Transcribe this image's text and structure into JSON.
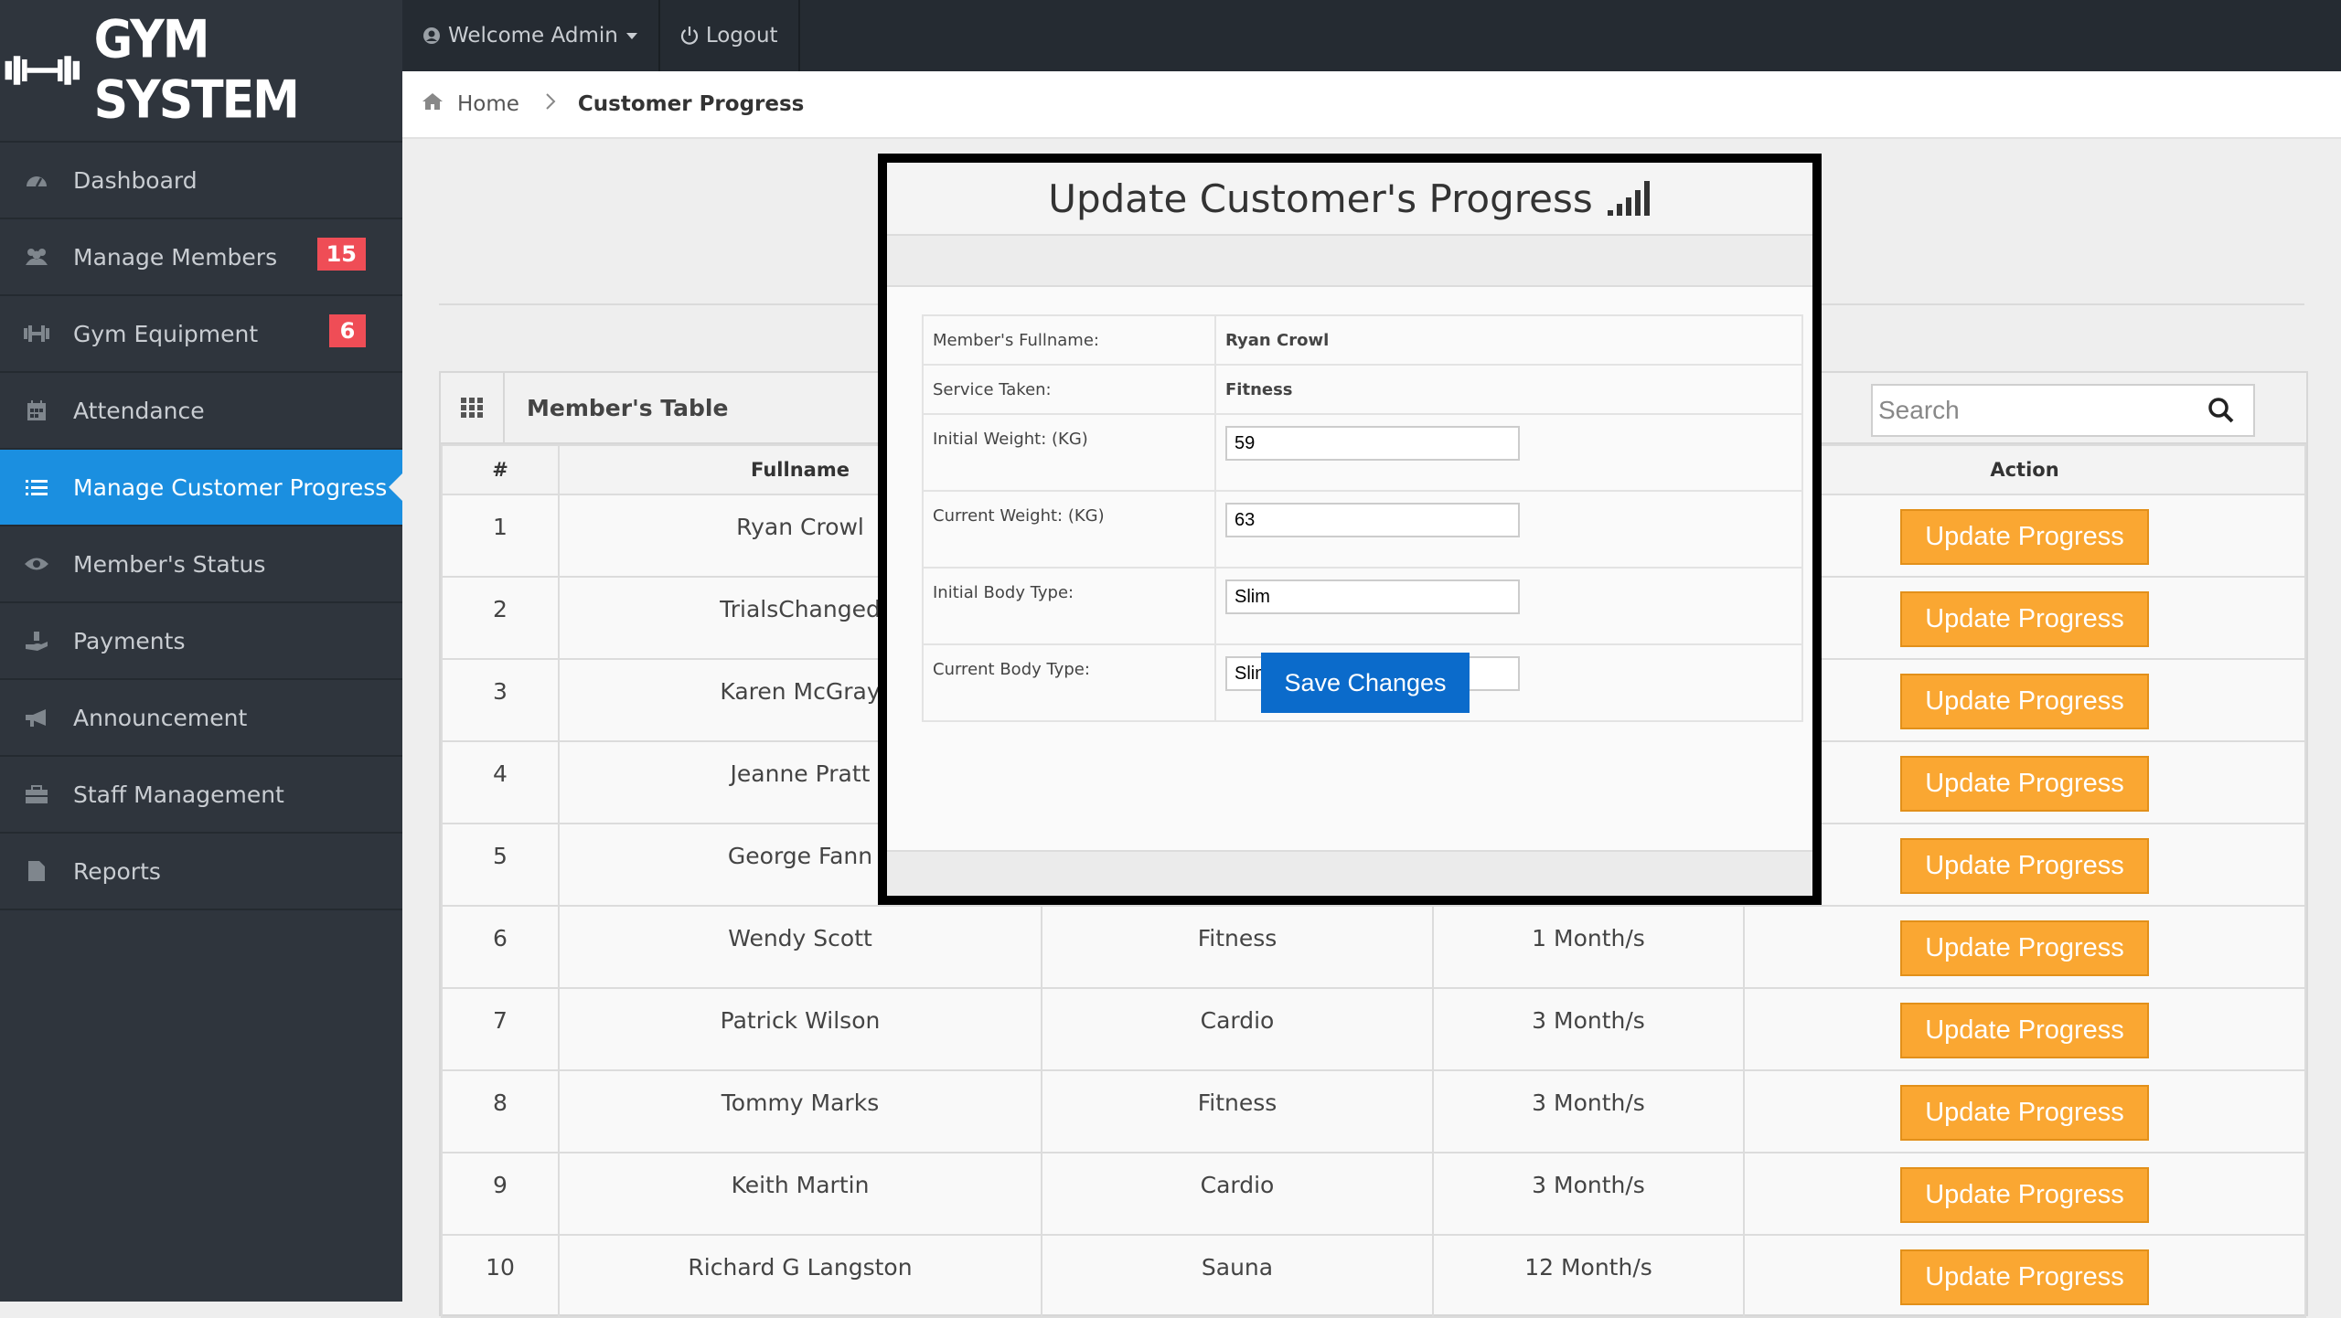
{
  "app": {
    "logo_text": "GYM SYSTEM"
  },
  "topbar": {
    "welcome": "Welcome Admin",
    "logout": "Logout"
  },
  "breadcrumb": {
    "home": "Home",
    "current": "Customer Progress"
  },
  "sidebar": {
    "items": [
      {
        "label": "Dashboard",
        "icon": "dashboard-icon"
      },
      {
        "label": "Manage Members",
        "icon": "users-icon",
        "badge": "15"
      },
      {
        "label": "Gym Equipment",
        "icon": "dumbbell-icon",
        "badge": "6"
      },
      {
        "label": "Attendance",
        "icon": "calendar-icon"
      },
      {
        "label": "Manage Customer Progress",
        "icon": "list-icon",
        "active": true
      },
      {
        "label": "Member's Status",
        "icon": "eye-icon"
      },
      {
        "label": "Payments",
        "icon": "hand-money-icon"
      },
      {
        "label": "Announcement",
        "icon": "megaphone-icon"
      },
      {
        "label": "Staff Management",
        "icon": "briefcase-icon"
      },
      {
        "label": "Reports",
        "icon": "file-icon"
      }
    ]
  },
  "panel": {
    "title": "Member's Table",
    "search_placeholder": "Search",
    "columns": [
      "#",
      "Fullname",
      "",
      "",
      "Action"
    ],
    "action_label": "Update Progress",
    "rows": [
      {
        "num": "1",
        "name": "Ryan Crowl",
        "service": "",
        "plan": ""
      },
      {
        "num": "2",
        "name": "TrialsChanged",
        "service": "",
        "plan": ""
      },
      {
        "num": "3",
        "name": "Karen McGray",
        "service": "",
        "plan": ""
      },
      {
        "num": "4",
        "name": "Jeanne Pratt",
        "service": "",
        "plan": ""
      },
      {
        "num": "5",
        "name": "George Fann",
        "service": "",
        "plan": ""
      },
      {
        "num": "6",
        "name": "Wendy Scott",
        "service": "Fitness",
        "plan": "1 Month/s"
      },
      {
        "num": "7",
        "name": "Patrick Wilson",
        "service": "Cardio",
        "plan": "3 Month/s"
      },
      {
        "num": "8",
        "name": "Tommy Marks",
        "service": "Fitness",
        "plan": "3 Month/s"
      },
      {
        "num": "9",
        "name": "Keith Martin",
        "service": "Cardio",
        "plan": "3 Month/s"
      },
      {
        "num": "10",
        "name": "Richard G Langston",
        "service": "Sauna",
        "plan": "12 Month/s"
      }
    ]
  },
  "modal": {
    "title": "Update Customer's Progress",
    "fullname_label": "Member's Fullname:",
    "fullname_value": "Ryan Crowl",
    "service_label": "Service Taken:",
    "service_value": "Fitness",
    "initial_weight_label": "Initial Weight: (KG)",
    "initial_weight_value": "59",
    "current_weight_label": "Current Weight: (KG)",
    "current_weight_value": "63",
    "initial_body_label": "Initial Body Type:",
    "initial_body_value": "Slim",
    "current_body_label": "Current Body Type:",
    "current_body_value": "Slim",
    "save_label": "Save Changes"
  },
  "colors": {
    "accent": "#1b8fe0",
    "action": "#faa732",
    "save": "#0b6bcb",
    "badge": "#ef4d56"
  }
}
